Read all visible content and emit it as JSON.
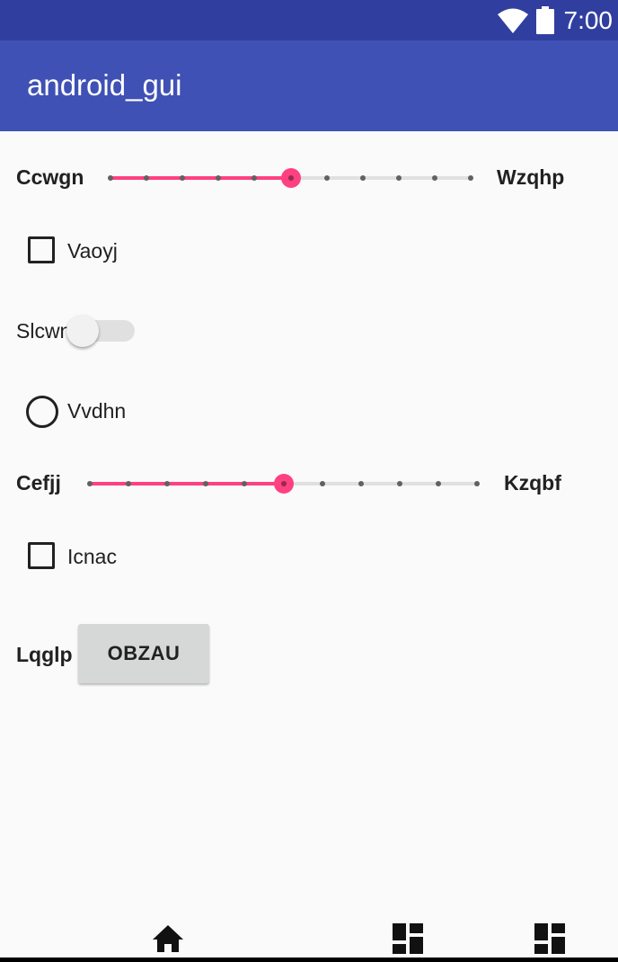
{
  "status_bar": {
    "time": "7:00",
    "wifi_icon": "wifi-icon",
    "battery_icon": "battery-icon"
  },
  "app_bar": {
    "title": "android_gui"
  },
  "seekbar_1": {
    "start_label": "Ccwgn",
    "end_label": "Wzqhp",
    "value": 5,
    "max": 10
  },
  "checkbox_1": {
    "label": "Vaoyj",
    "checked": false
  },
  "switch_1": {
    "label": "Slcwn",
    "on": false
  },
  "radio_1": {
    "label": "Vvdhn",
    "selected": false
  },
  "seekbar_2": {
    "start_label": "Cefjj",
    "end_label": "Kzqbf",
    "value": 5,
    "max": 10
  },
  "checkbox_2": {
    "label": "Icnac",
    "checked": false
  },
  "button_row": {
    "label": "Lqglp",
    "button_label": "OBZAU"
  },
  "bottom_nav": {
    "items": [
      "home-icon",
      "dashboard-icon",
      "dashboard-icon"
    ]
  },
  "colors": {
    "primary": "#3f51b5",
    "primary_dark": "#303f9f",
    "accent": "#ff4081",
    "background": "#fafafa"
  }
}
